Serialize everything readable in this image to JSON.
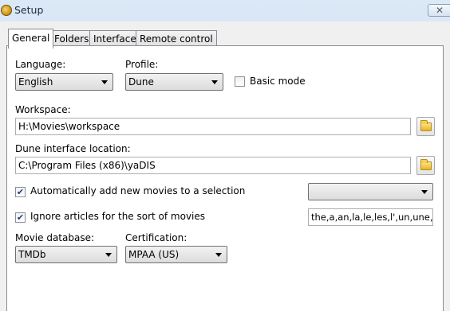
{
  "window": {
    "title": "Setup",
    "close_glyph": "✕"
  },
  "tabs": [
    {
      "label": "General"
    },
    {
      "label": "Folders"
    },
    {
      "label": "Interface"
    },
    {
      "label": "Remote control"
    }
  ],
  "general": {
    "language": {
      "label": "Language:",
      "value": "English"
    },
    "profile": {
      "label": "Profile:",
      "value": "Dune"
    },
    "basic_mode": {
      "label": "Basic mode",
      "checked": false
    },
    "workspace": {
      "label": "Workspace:",
      "value": "H:\\Movies\\workspace"
    },
    "dune_interface": {
      "label": "Dune interface location:",
      "value": "C:\\Program Files (x86)\\yaDIS"
    },
    "auto_add": {
      "label": "Automatically add new movies to a selection",
      "checked": true,
      "selection_value": ""
    },
    "ignore_articles": {
      "label": "Ignore articles for the sort of movies",
      "checked": true,
      "articles_value": "the,a,an,la,le,les,l',un,une,des"
    },
    "movie_database": {
      "label": "Movie database:",
      "value": "TMDb"
    },
    "certification": {
      "label": "Certification:",
      "value": "MPAA (US)"
    },
    "check_glyph": "✔"
  }
}
